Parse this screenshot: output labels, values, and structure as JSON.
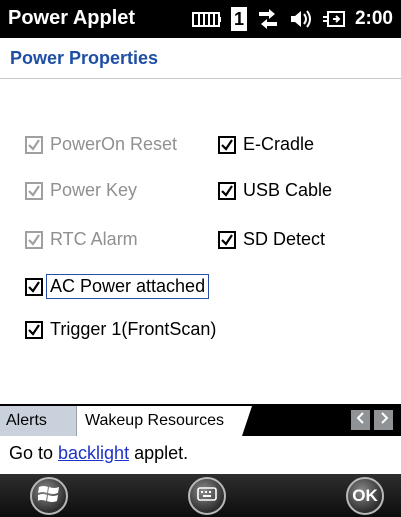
{
  "status_bar": {
    "app_title": "Power Applet",
    "signal_number": "1",
    "clock": "2:00"
  },
  "header": {
    "page_title": "Power Properties"
  },
  "checkboxes": {
    "poweron_reset": {
      "label": "PowerOn Reset",
      "checked": true,
      "enabled": false
    },
    "power_key": {
      "label": "Power Key",
      "checked": true,
      "enabled": false
    },
    "rtc_alarm": {
      "label": "RTC Alarm",
      "checked": true,
      "enabled": false
    },
    "ac_power": {
      "label": "AC Power attached",
      "checked": true,
      "enabled": true
    },
    "trigger1": {
      "label": "Trigger 1(FrontScan)",
      "checked": true,
      "enabled": true
    },
    "e_cradle": {
      "label": "E-Cradle",
      "checked": true,
      "enabled": true
    },
    "usb_cable": {
      "label": "USB Cable",
      "checked": true,
      "enabled": true
    },
    "sd_detect": {
      "label": "SD Detect",
      "checked": true,
      "enabled": true
    }
  },
  "tabs": {
    "alerts": "Alerts",
    "wakeup": "Wakeup Resources"
  },
  "footer": {
    "prefix": "Go to ",
    "link": "backlight",
    "suffix": " applet."
  },
  "softkeys": {
    "ok": "OK"
  },
  "colors": {
    "title_blue": "#1f4fa5",
    "link_blue": "#1d32c8",
    "focus_border": "#2a4fa8"
  }
}
